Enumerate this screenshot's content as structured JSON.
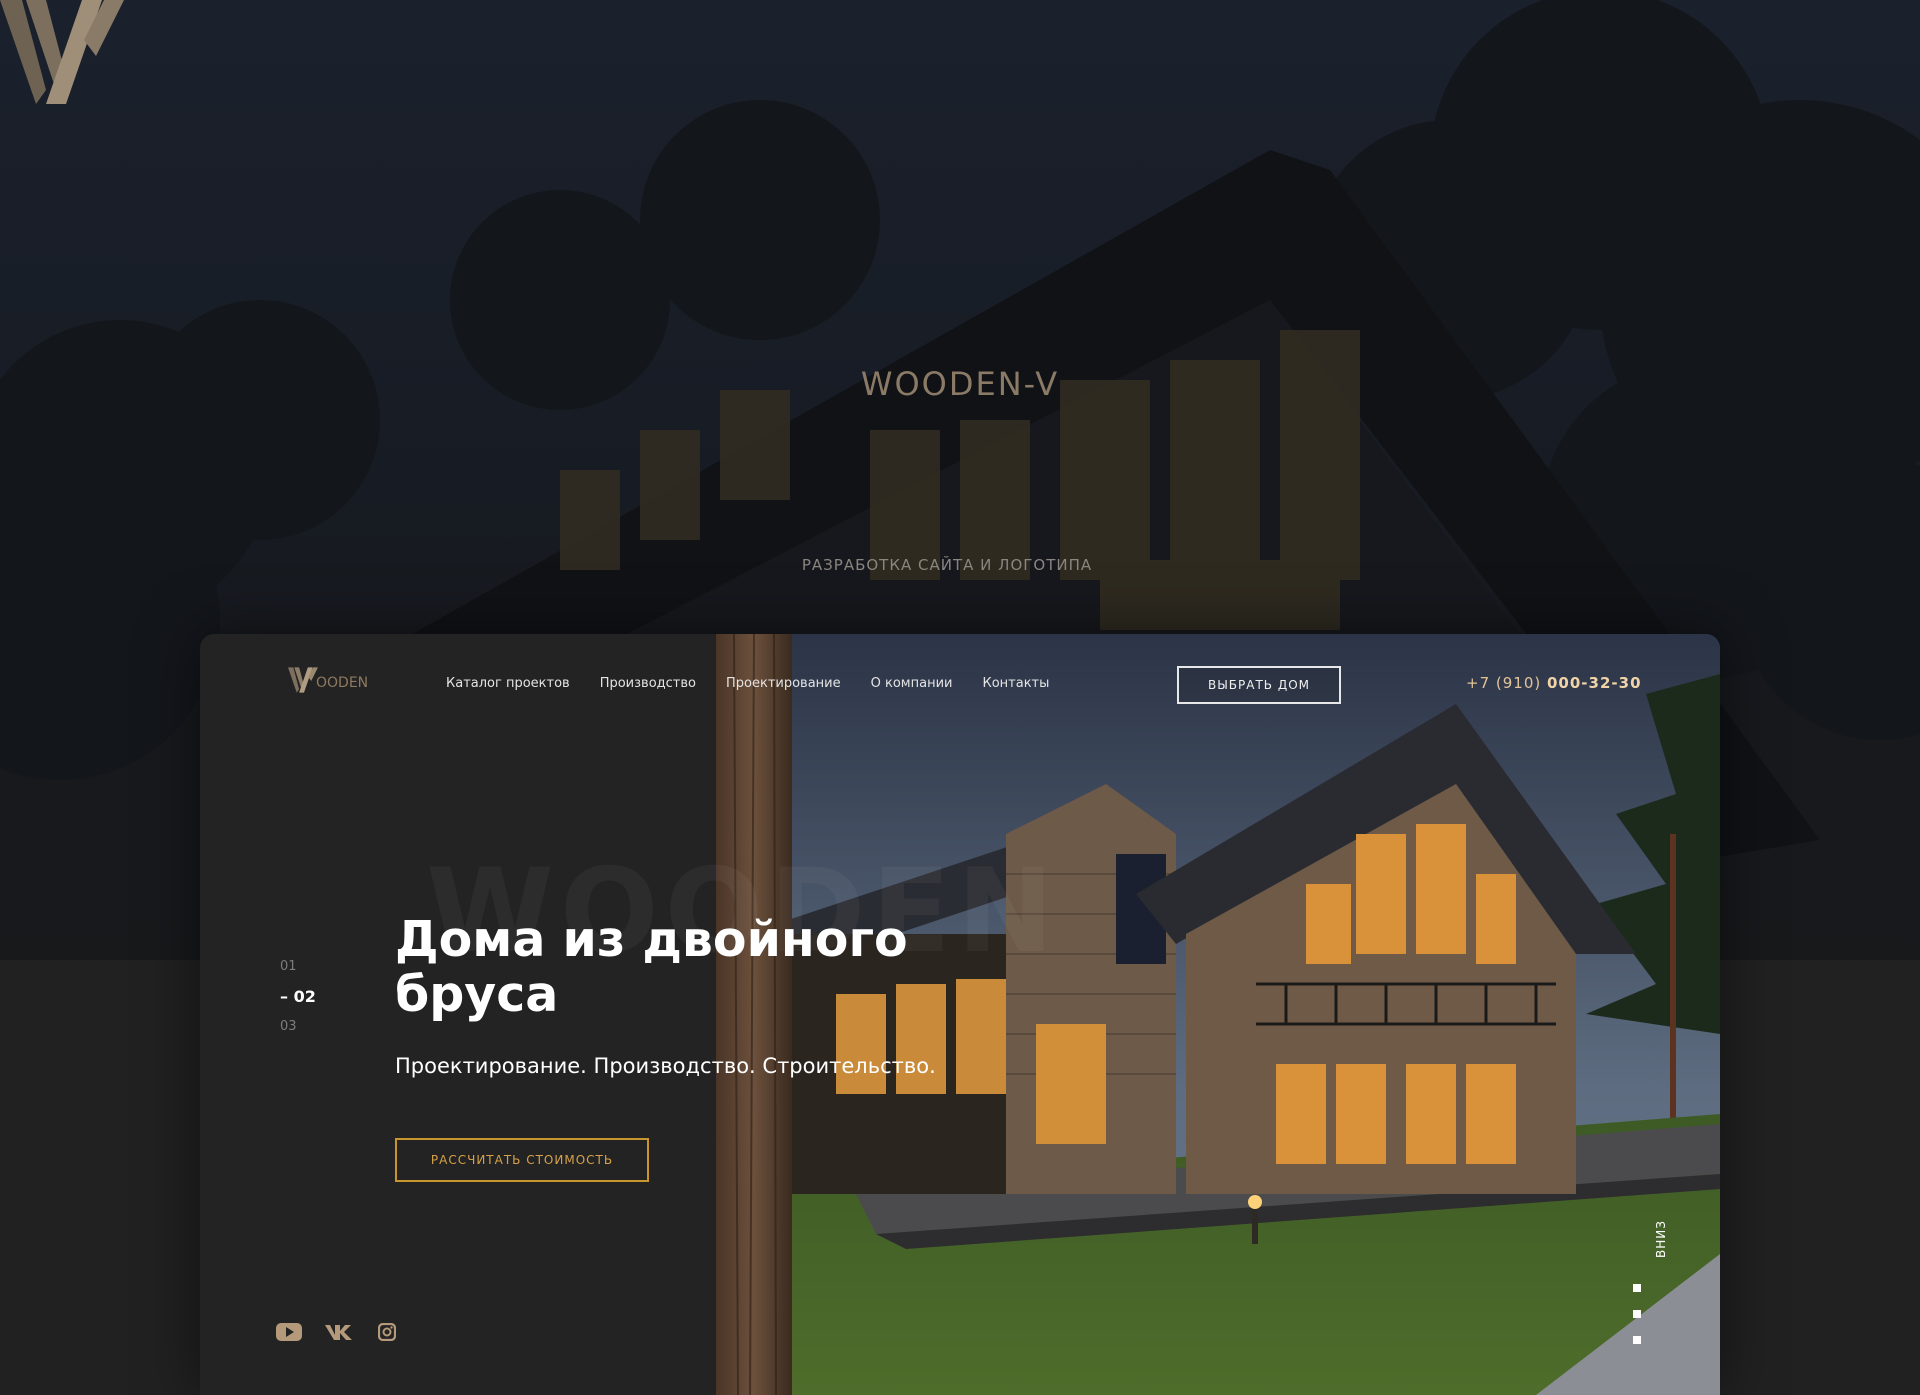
{
  "presentation": {
    "brand_name": "WOODEN-V",
    "subtitle": "РАЗРАБОТКА САЙТА И ЛОГОТИПА"
  },
  "site": {
    "logo_text": "OODEN",
    "nav": [
      "Каталог проектов",
      "Производство",
      "Проектирование",
      "О компании",
      "Контакты"
    ],
    "choose_button": "ВЫБРАТЬ ДОМ",
    "phone_prefix": "+7 (910)",
    "phone_number": "000-32-30",
    "watermark": "WOODEN",
    "slides": [
      "01",
      "– 02",
      "03"
    ],
    "active_slide": 2,
    "hero_title": "Дома из двойного бруса",
    "hero_subtitle": "Проектирование. Производство. Строительство.",
    "cta_button": "РАССЧИТАТЬ СТОИМОСТЬ",
    "scroll_label": "ВНИЗ",
    "socials": [
      "youtube-icon",
      "vk-icon",
      "instagram-icon"
    ]
  },
  "colors": {
    "accent_gold": "#c9962e",
    "brand_bronze": "#8a7a66",
    "panel_bg": "#232323"
  }
}
